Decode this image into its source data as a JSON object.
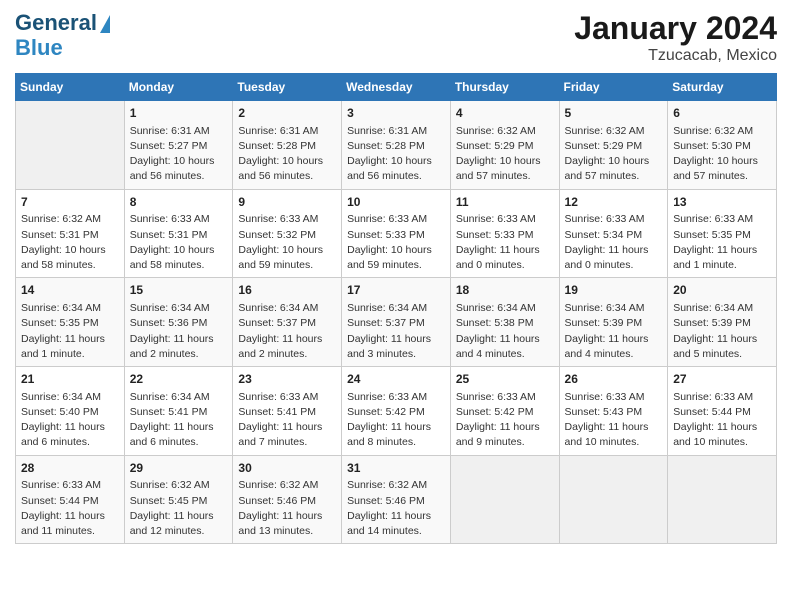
{
  "header": {
    "logo_line1": "General",
    "logo_line2": "Blue",
    "title": "January 2024",
    "subtitle": "Tzucacab, Mexico"
  },
  "days_of_week": [
    "Sunday",
    "Monday",
    "Tuesday",
    "Wednesday",
    "Thursday",
    "Friday",
    "Saturday"
  ],
  "weeks": [
    [
      {
        "day": "",
        "info": ""
      },
      {
        "day": "1",
        "info": "Sunrise: 6:31 AM\nSunset: 5:27 PM\nDaylight: 10 hours\nand 56 minutes."
      },
      {
        "day": "2",
        "info": "Sunrise: 6:31 AM\nSunset: 5:28 PM\nDaylight: 10 hours\nand 56 minutes."
      },
      {
        "day": "3",
        "info": "Sunrise: 6:31 AM\nSunset: 5:28 PM\nDaylight: 10 hours\nand 56 minutes."
      },
      {
        "day": "4",
        "info": "Sunrise: 6:32 AM\nSunset: 5:29 PM\nDaylight: 10 hours\nand 57 minutes."
      },
      {
        "day": "5",
        "info": "Sunrise: 6:32 AM\nSunset: 5:29 PM\nDaylight: 10 hours\nand 57 minutes."
      },
      {
        "day": "6",
        "info": "Sunrise: 6:32 AM\nSunset: 5:30 PM\nDaylight: 10 hours\nand 57 minutes."
      }
    ],
    [
      {
        "day": "7",
        "info": "Sunrise: 6:32 AM\nSunset: 5:31 PM\nDaylight: 10 hours\nand 58 minutes."
      },
      {
        "day": "8",
        "info": "Sunrise: 6:33 AM\nSunset: 5:31 PM\nDaylight: 10 hours\nand 58 minutes."
      },
      {
        "day": "9",
        "info": "Sunrise: 6:33 AM\nSunset: 5:32 PM\nDaylight: 10 hours\nand 59 minutes."
      },
      {
        "day": "10",
        "info": "Sunrise: 6:33 AM\nSunset: 5:33 PM\nDaylight: 10 hours\nand 59 minutes."
      },
      {
        "day": "11",
        "info": "Sunrise: 6:33 AM\nSunset: 5:33 PM\nDaylight: 11 hours\nand 0 minutes."
      },
      {
        "day": "12",
        "info": "Sunrise: 6:33 AM\nSunset: 5:34 PM\nDaylight: 11 hours\nand 0 minutes."
      },
      {
        "day": "13",
        "info": "Sunrise: 6:33 AM\nSunset: 5:35 PM\nDaylight: 11 hours\nand 1 minute."
      }
    ],
    [
      {
        "day": "14",
        "info": "Sunrise: 6:34 AM\nSunset: 5:35 PM\nDaylight: 11 hours\nand 1 minute."
      },
      {
        "day": "15",
        "info": "Sunrise: 6:34 AM\nSunset: 5:36 PM\nDaylight: 11 hours\nand 2 minutes."
      },
      {
        "day": "16",
        "info": "Sunrise: 6:34 AM\nSunset: 5:37 PM\nDaylight: 11 hours\nand 2 minutes."
      },
      {
        "day": "17",
        "info": "Sunrise: 6:34 AM\nSunset: 5:37 PM\nDaylight: 11 hours\nand 3 minutes."
      },
      {
        "day": "18",
        "info": "Sunrise: 6:34 AM\nSunset: 5:38 PM\nDaylight: 11 hours\nand 4 minutes."
      },
      {
        "day": "19",
        "info": "Sunrise: 6:34 AM\nSunset: 5:39 PM\nDaylight: 11 hours\nand 4 minutes."
      },
      {
        "day": "20",
        "info": "Sunrise: 6:34 AM\nSunset: 5:39 PM\nDaylight: 11 hours\nand 5 minutes."
      }
    ],
    [
      {
        "day": "21",
        "info": "Sunrise: 6:34 AM\nSunset: 5:40 PM\nDaylight: 11 hours\nand 6 minutes."
      },
      {
        "day": "22",
        "info": "Sunrise: 6:34 AM\nSunset: 5:41 PM\nDaylight: 11 hours\nand 6 minutes."
      },
      {
        "day": "23",
        "info": "Sunrise: 6:33 AM\nSunset: 5:41 PM\nDaylight: 11 hours\nand 7 minutes."
      },
      {
        "day": "24",
        "info": "Sunrise: 6:33 AM\nSunset: 5:42 PM\nDaylight: 11 hours\nand 8 minutes."
      },
      {
        "day": "25",
        "info": "Sunrise: 6:33 AM\nSunset: 5:42 PM\nDaylight: 11 hours\nand 9 minutes."
      },
      {
        "day": "26",
        "info": "Sunrise: 6:33 AM\nSunset: 5:43 PM\nDaylight: 11 hours\nand 10 minutes."
      },
      {
        "day": "27",
        "info": "Sunrise: 6:33 AM\nSunset: 5:44 PM\nDaylight: 11 hours\nand 10 minutes."
      }
    ],
    [
      {
        "day": "28",
        "info": "Sunrise: 6:33 AM\nSunset: 5:44 PM\nDaylight: 11 hours\nand 11 minutes."
      },
      {
        "day": "29",
        "info": "Sunrise: 6:32 AM\nSunset: 5:45 PM\nDaylight: 11 hours\nand 12 minutes."
      },
      {
        "day": "30",
        "info": "Sunrise: 6:32 AM\nSunset: 5:46 PM\nDaylight: 11 hours\nand 13 minutes."
      },
      {
        "day": "31",
        "info": "Sunrise: 6:32 AM\nSunset: 5:46 PM\nDaylight: 11 hours\nand 14 minutes."
      },
      {
        "day": "",
        "info": ""
      },
      {
        "day": "",
        "info": ""
      },
      {
        "day": "",
        "info": ""
      }
    ]
  ]
}
